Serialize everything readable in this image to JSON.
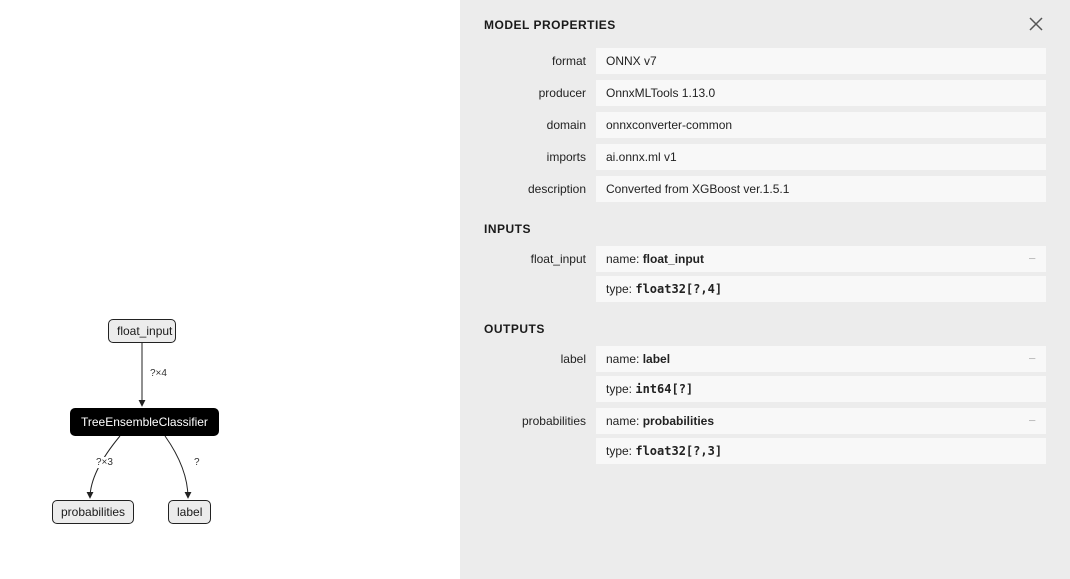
{
  "panel": {
    "title": "MODEL PROPERTIES",
    "close_icon": "close",
    "sections": {
      "general": [
        {
          "label": "format",
          "value": "ONNX v7"
        },
        {
          "label": "producer",
          "value": "OnnxMLTools 1.13.0"
        },
        {
          "label": "domain",
          "value": "onnxconverter-common"
        },
        {
          "label": "imports",
          "value": "ai.onnx.ml v1"
        },
        {
          "label": "description",
          "value": "Converted from XGBoost ver.1.5.1"
        }
      ],
      "inputs_title": "INPUTS",
      "inputs": [
        {
          "label": "float_input",
          "name_prefix": "name: ",
          "name": "float_input",
          "type_prefix": "type: ",
          "type": "float32[?,4]"
        }
      ],
      "outputs_title": "OUTPUTS",
      "outputs": [
        {
          "label": "label",
          "name_prefix": "name: ",
          "name": "label",
          "type_prefix": "type: ",
          "type": "int64[?]"
        },
        {
          "label": "probabilities",
          "name_prefix": "name: ",
          "name": "probabilities",
          "type_prefix": "type: ",
          "type": "float32[?,3]"
        }
      ]
    }
  },
  "graph": {
    "nodes": {
      "input": {
        "label": "float_input"
      },
      "op": {
        "label": "TreeEnsembleClassifier"
      },
      "out1": {
        "label": "probabilities"
      },
      "out2": {
        "label": "label"
      }
    },
    "edges": {
      "input_to_op": "?×4",
      "op_to_prob": "?×3",
      "op_to_label": "?"
    }
  }
}
